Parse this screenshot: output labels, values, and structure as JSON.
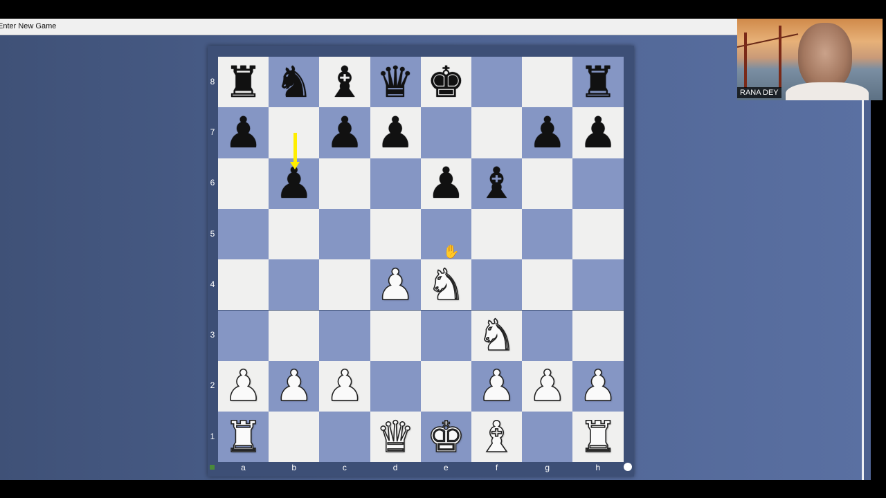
{
  "window": {
    "title": "Enter New Game"
  },
  "board": {
    "files": [
      "a",
      "b",
      "c",
      "d",
      "e",
      "f",
      "g",
      "h"
    ],
    "ranks": [
      "8",
      "7",
      "6",
      "5",
      "4",
      "3",
      "2",
      "1"
    ],
    "square_colors": {
      "light": "#f0f0ef",
      "dark": "#8596c4"
    },
    "position": [
      [
        "♜",
        "♞",
        "♝",
        "♛",
        "♚",
        "",
        "",
        "♜"
      ],
      [
        "♟",
        "",
        "♟",
        "♟",
        "",
        "",
        "♟",
        "♟"
      ],
      [
        "",
        "♟",
        "",
        "",
        "♟",
        "♝",
        "",
        ""
      ],
      [
        "",
        "",
        "",
        "",
        "",
        "",
        "",
        ""
      ],
      [
        "",
        "",
        "",
        "♙",
        "♘",
        "",
        "",
        ""
      ],
      [
        "",
        "",
        "",
        "",
        "",
        "♘",
        "",
        ""
      ],
      [
        "♙",
        "♙",
        "♙",
        "",
        "",
        "♙",
        "♙",
        "♙"
      ],
      [
        "♖",
        "",
        "",
        "♕",
        "♔",
        "♗",
        "",
        "♖"
      ]
    ],
    "side_to_move": "white",
    "last_move_arrow": {
      "from": "b7",
      "to": "b6",
      "color": "#ffee00"
    }
  },
  "webcam": {
    "name": "RANA DEY"
  }
}
